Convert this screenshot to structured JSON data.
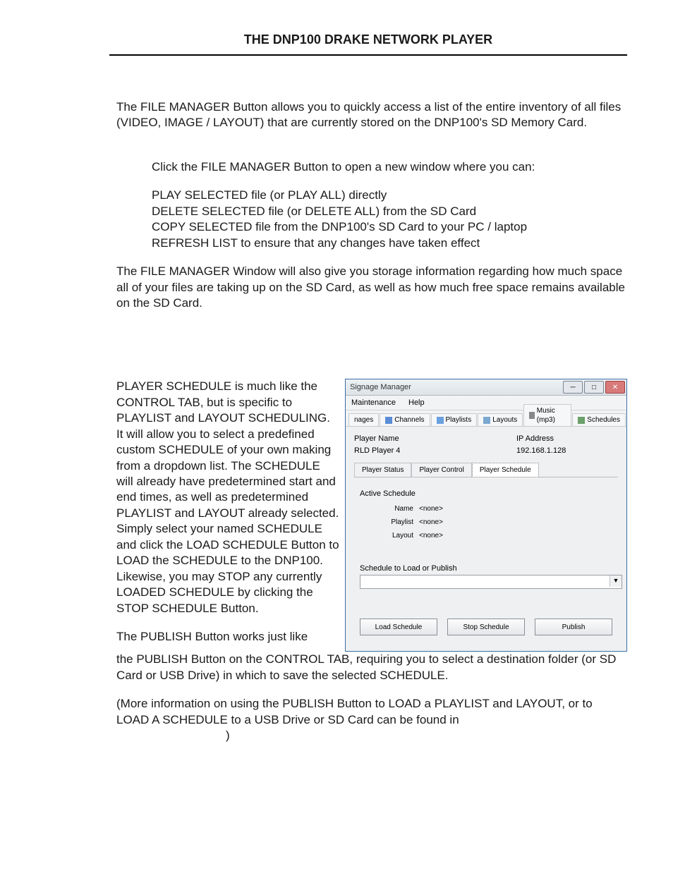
{
  "header": "THE DNP100 DRAKE NETWORK PLAYER",
  "p1": "The FILE MANAGER Button allows you to quickly access a list of the entire inventory of all files (VIDEO, IMAGE / LAYOUT) that are currently stored on the DNP100's SD Memory Card.",
  "p2": "Click the FILE MANAGER Button to open a new window where you can:",
  "list": {
    "l1": "PLAY SELECTED file (or PLAY ALL) directly",
    "l2": "DELETE SELECTED file (or DELETE ALL) from the SD Card",
    "l3": "COPY SELECTED file from the DNP100's SD Card to your PC / laptop",
    "l4": "REFRESH LIST to ensure that any changes have taken effect"
  },
  "p3": "The FILE MANAGER Window will also give you storage information regarding how much space all of your files are taking up on the SD Card, as well as how much free space remains available on the SD Card.",
  "p4": "PLAYER SCHEDULE is much like the CONTROL TAB, but is specific to PLAYLIST and LAYOUT SCHEDULING.  It will allow you to select a predefined custom SCHEDULE of your own making from a dropdown list.  The SCHEDULE will already have predetermined start and end times, as well as predetermined PLAYLIST and LAYOUT already selected.  Simply select your named SCHEDULE and click the LOAD SCHEDULE Button to LOAD the SCHEDULE to the DNP100.  Likewise, you may STOP any currently LOADED SCHEDULE by clicking the",
  "p4b": "STOP SCHEDULE Button.",
  "p5": "The PUBLISH Button works just like",
  "p5full": "the PUBLISH Button on the CONTROL TAB, requiring you to select a destination folder (or SD Card or USB Drive) in which to save the selected SCHEDULE.",
  "p6": "(More information on using the PUBLISH Button to LOAD a PLAYLIST and LAYOUT, or to LOAD A SCHEDULE to a USB Drive or SD Card can be found in",
  "p6end": ")",
  "window": {
    "title": "Signage Manager",
    "menu": {
      "m1": "Maintenance",
      "m2": "Help"
    },
    "tabs": {
      "t0": "nages",
      "t1": "Channels",
      "t2": "Playlists",
      "t3": "Layouts",
      "t4": "Music (mp3)",
      "t5": "Schedules"
    },
    "playerName": {
      "label": "Player Name",
      "value": "RLD Player 4"
    },
    "ipAddress": {
      "label": "IP Address",
      "value": "192.168.1.128"
    },
    "subtabs": {
      "s1": "Player Status",
      "s2": "Player Control",
      "s3": "Player Schedule"
    },
    "activeSchedule": {
      "title": "Active Schedule",
      "name": {
        "label": "Name",
        "value": "<none>"
      },
      "playlist": {
        "label": "Playlist",
        "value": "<none>"
      },
      "layout": {
        "label": "Layout",
        "value": "<none>"
      }
    },
    "loadGroup": "Schedule to Load or Publish",
    "buttons": {
      "b1": "Load Schedule",
      "b2": "Stop Schedule",
      "b3": "Publish"
    }
  }
}
